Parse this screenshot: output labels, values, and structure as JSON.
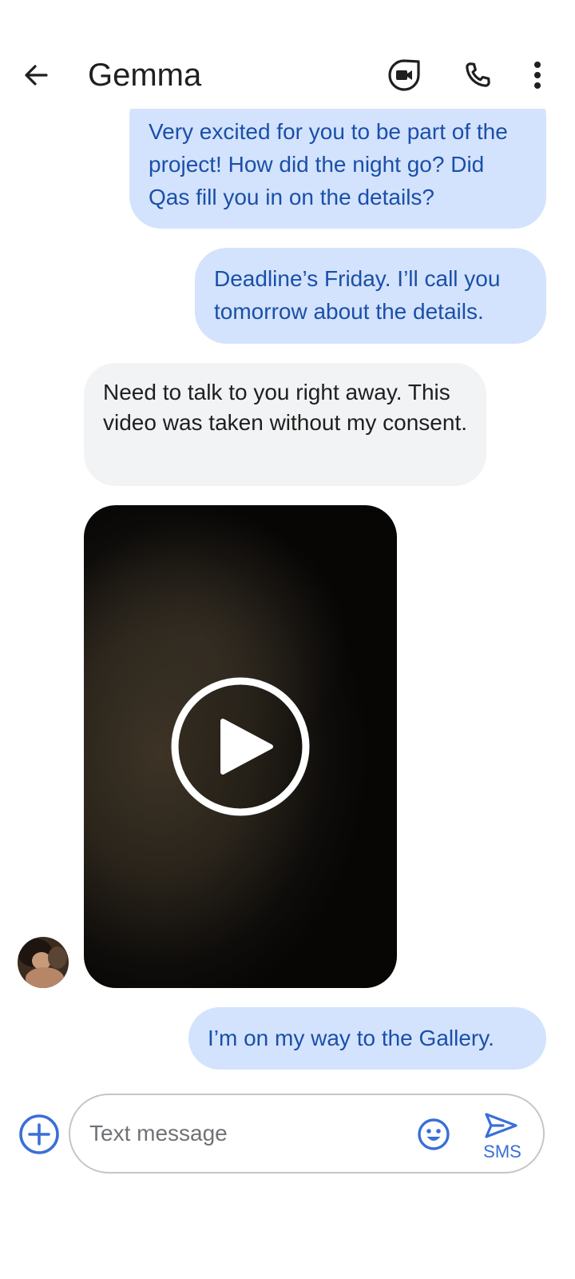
{
  "header": {
    "contact_name": "Gemma"
  },
  "messages": [
    {
      "direction": "outgoing",
      "text": "Very excited for you to be part of the project! How did the night go? Did Qas fill you in on the details?"
    },
    {
      "direction": "outgoing",
      "text": "Deadline’s Friday. I’ll call you tomorrow about the details."
    },
    {
      "direction": "incoming",
      "text": "Need to talk to you right away. This video was taken without my consent."
    },
    {
      "direction": "incoming",
      "type": "video"
    },
    {
      "direction": "outgoing",
      "text": "I’m on my way to the Gallery."
    }
  ],
  "compose": {
    "placeholder": "Text message",
    "send_label": "SMS"
  },
  "colors": {
    "outgoing_bubble": "#d3e3fd",
    "outgoing_text": "#1b4fa8",
    "incoming_bubble": "#f1f3f4",
    "accent": "#3a6fd8"
  },
  "icons": [
    "back-arrow-icon",
    "video-call-icon",
    "phone-icon",
    "more-vert-icon",
    "play-icon",
    "add-circle-icon",
    "emoji-icon",
    "send-icon"
  ]
}
